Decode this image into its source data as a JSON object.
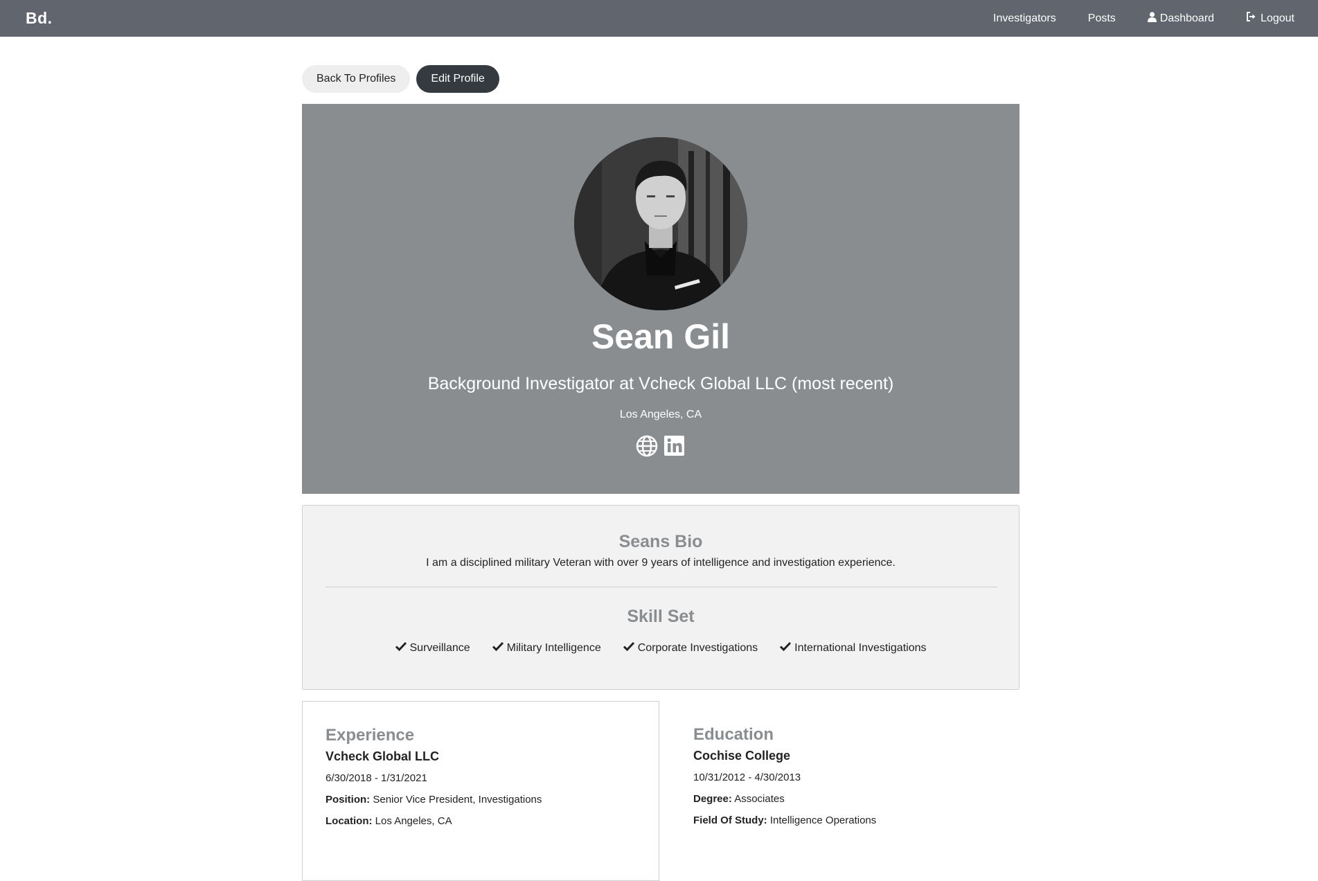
{
  "nav": {
    "brand": "Bd.",
    "links": {
      "investigators": "Investigators",
      "posts": "Posts",
      "dashboard": "Dashboard",
      "logout": "Logout"
    },
    "background": "#61656e"
  },
  "actions": {
    "back": "Back To Profiles",
    "edit": "Edit Profile"
  },
  "profile": {
    "name": "Sean Gil",
    "headline": "Background Investigator at Vcheck Global LLC (most recent)",
    "location": "Los Angeles, CA",
    "social_icons": [
      "globe-icon",
      "linkedin-icon"
    ],
    "hero_color": "#8a8d90"
  },
  "bio": {
    "heading": "Seans Bio",
    "text": "I am a disciplined military Veteran with over 9 years of intelligence and investigation experience."
  },
  "skills": {
    "heading": "Skill Set",
    "items": [
      "Surveillance",
      "Military Intelligence",
      "Corporate Investigations",
      "International Investigations"
    ]
  },
  "experience": {
    "heading": "Experience",
    "company": "Vcheck Global LLC",
    "dates": "6/30/2018 - 1/31/2021",
    "position_label": "Position:",
    "position": "Senior Vice President, Investigations",
    "location_label": "Location:",
    "location": "Los Angeles, CA"
  },
  "education": {
    "heading": "Education",
    "school": "Cochise College",
    "dates": "10/31/2012 - 4/30/2013",
    "degree_label": "Degree:",
    "degree": "Associates",
    "field_label": "Field Of Study:",
    "field": "Intelligence Operations"
  }
}
